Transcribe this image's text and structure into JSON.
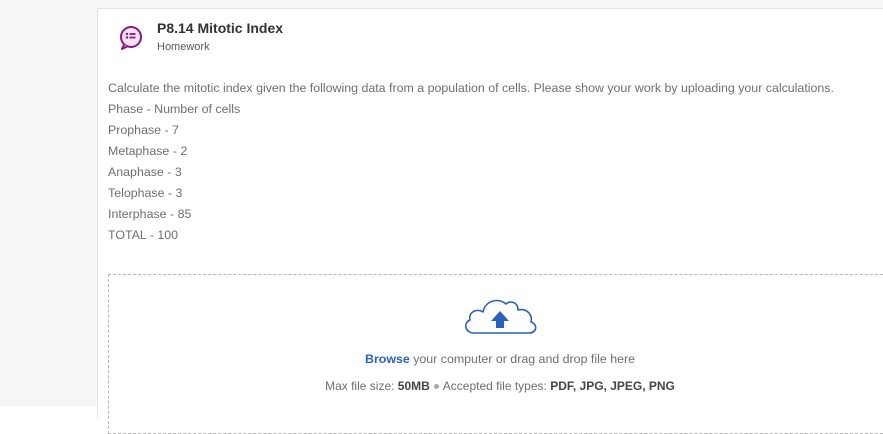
{
  "assignment": {
    "title": "P8.14 Mitotic Index",
    "type": "Homework",
    "icon": "homework-list-icon",
    "accent_color": "#8b1a7e"
  },
  "instructions": {
    "lines": [
      "Calculate the mitotic index given the following data from a population of cells. Please show your work by uploading your calculations.",
      "Phase - Number of cells",
      "Prophase - 7",
      "Metaphase - 2",
      "Anaphase - 3",
      "Telophase - 3",
      "Interphase - 85",
      "TOTAL - 100"
    ]
  },
  "upload": {
    "icon": "cloud-upload-icon",
    "browse_label": "Browse",
    "prompt_rest": " your computer or drag and drop file here",
    "max_size_label": "Max file size: ",
    "max_size_value": "50MB",
    "types_label": "Accepted file types: ",
    "types_value": "PDF, JPG, JPEG, PNG",
    "accent_color": "#2a61b8"
  }
}
